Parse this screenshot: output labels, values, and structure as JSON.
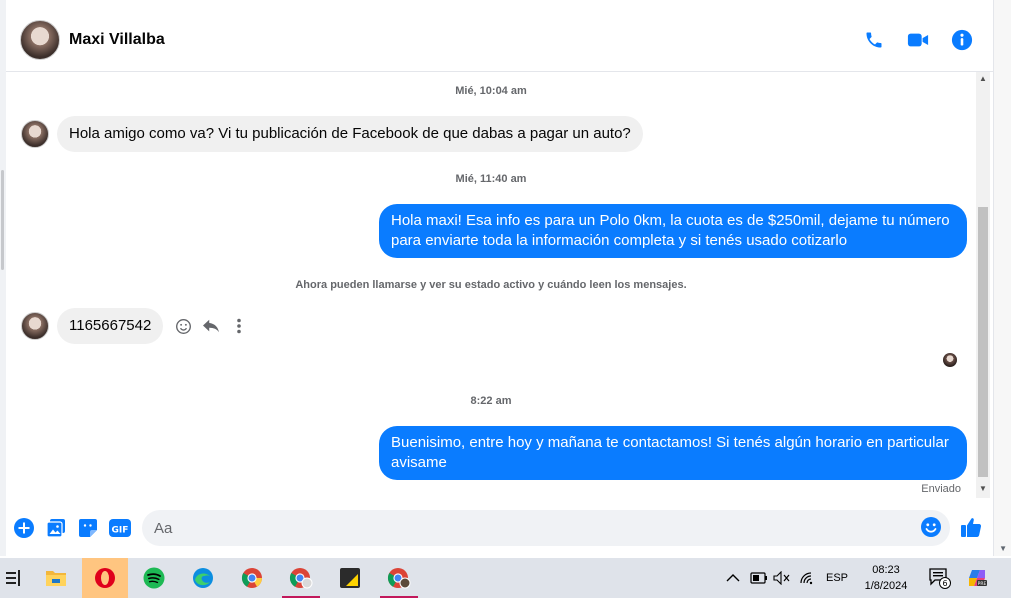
{
  "conversation": {
    "contact_name": "Maxi Villalba",
    "header_icons": [
      "phone-icon",
      "video-camera-icon",
      "info-icon"
    ]
  },
  "messages": {
    "timestamp_1": "Mié, 10:04 am",
    "incoming_1": "Hola amigo como va? Vi tu publicación de Facebook de que dabas a pagar un auto?",
    "timestamp_2": "Mié, 11:40 am",
    "outgoing_1_line1": "Hola maxi! Esa info es para un Polo 0km, la cuota es de $250mil, dejame tu número",
    "outgoing_1_line2": "para enviarte toda la información completa y si tenés usado cotizarlo",
    "system_notice": "Ahora pueden llamarse y ver su estado activo y cuándo leen los mensajes.",
    "incoming_2": "1165667542",
    "timestamp_3": "8:22 am",
    "outgoing_2_line1": "Buenisimo, entre hoy y mañana te contactamos! Si tenés algún horario en particular",
    "outgoing_2_line2": "avisame",
    "delivery_status": "Enviado"
  },
  "composer": {
    "placeholder": "Aa",
    "icons": [
      "add-icon",
      "photo-icon",
      "sticker-icon",
      "gif-icon",
      "emoji-icon",
      "like-icon"
    ],
    "gif_label": "GIF"
  },
  "colors": {
    "accent": "#0a7cff",
    "incoming_bubble": "#f0f0f0",
    "taskbar": "#dfe3ea"
  },
  "taskbar": {
    "apps": [
      "task-view",
      "file-explorer",
      "opera",
      "spotify",
      "edge",
      "chrome",
      "chrome-profile",
      "sticky-notes",
      "chrome-profile-2"
    ],
    "language": "ESP",
    "time": "08:23",
    "date": "1/8/2024",
    "notification_count": "6"
  }
}
